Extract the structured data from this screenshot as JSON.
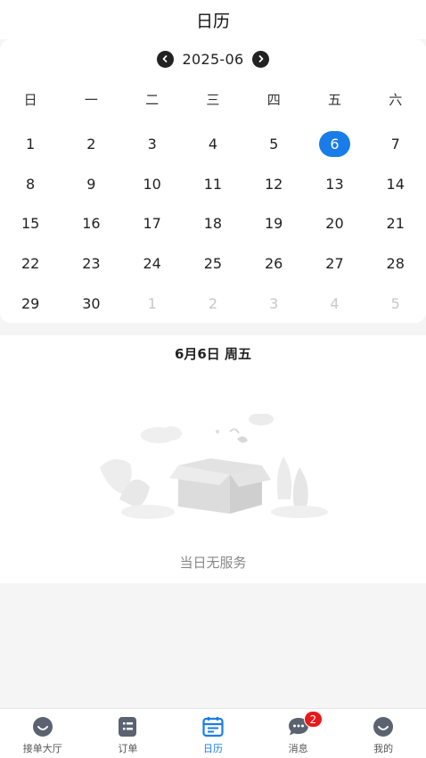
{
  "header": {
    "title": "日历"
  },
  "calendar": {
    "month_label": "2025-06",
    "weekdays": [
      "日",
      "一",
      "二",
      "三",
      "四",
      "五",
      "六"
    ],
    "days": [
      {
        "label": "1",
        "other": false
      },
      {
        "label": "2",
        "other": false
      },
      {
        "label": "3",
        "other": false
      },
      {
        "label": "4",
        "other": false
      },
      {
        "label": "5",
        "other": false
      },
      {
        "label": "6",
        "other": false,
        "selected": true
      },
      {
        "label": "7",
        "other": false
      },
      {
        "label": "8",
        "other": false
      },
      {
        "label": "9",
        "other": false
      },
      {
        "label": "10",
        "other": false
      },
      {
        "label": "11",
        "other": false
      },
      {
        "label": "12",
        "other": false
      },
      {
        "label": "13",
        "other": false
      },
      {
        "label": "14",
        "other": false
      },
      {
        "label": "15",
        "other": false
      },
      {
        "label": "16",
        "other": false
      },
      {
        "label": "17",
        "other": false
      },
      {
        "label": "18",
        "other": false
      },
      {
        "label": "19",
        "other": false
      },
      {
        "label": "20",
        "other": false
      },
      {
        "label": "21",
        "other": false
      },
      {
        "label": "22",
        "other": false
      },
      {
        "label": "23",
        "other": false
      },
      {
        "label": "24",
        "other": false
      },
      {
        "label": "25",
        "other": false
      },
      {
        "label": "26",
        "other": false
      },
      {
        "label": "27",
        "other": false
      },
      {
        "label": "28",
        "other": false
      },
      {
        "label": "29",
        "other": false
      },
      {
        "label": "30",
        "other": false
      },
      {
        "label": "1",
        "other": true
      },
      {
        "label": "2",
        "other": true
      },
      {
        "label": "3",
        "other": true
      },
      {
        "label": "4",
        "other": true
      },
      {
        "label": "5",
        "other": true
      }
    ],
    "accent_color": "#1a7ce8"
  },
  "day_panel": {
    "date_title": "6月6日 周五",
    "empty_text": "当日无服务",
    "illustration_icon": "empty-box-illustration"
  },
  "tabbar": {
    "tabs": [
      {
        "label": "接单大厅",
        "icon": "hall-icon",
        "active": false
      },
      {
        "label": "订单",
        "icon": "order-icon",
        "active": false
      },
      {
        "label": "日历",
        "icon": "calendar-icon",
        "active": true
      },
      {
        "label": "消息",
        "icon": "message-icon",
        "active": false,
        "badge": "2"
      },
      {
        "label": "我的",
        "icon": "profile-icon",
        "active": false
      }
    ]
  }
}
